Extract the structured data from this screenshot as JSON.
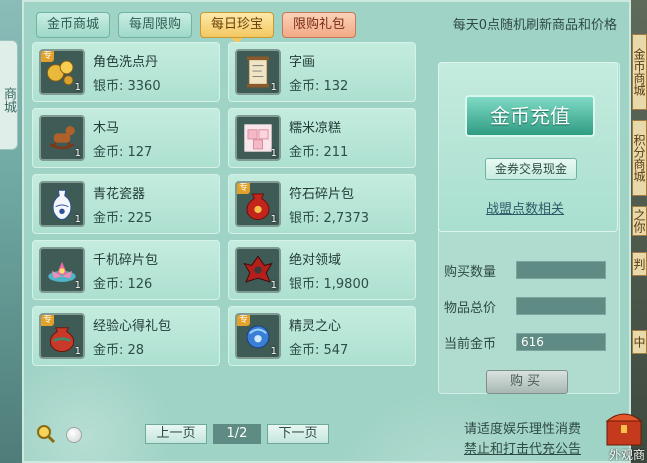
{
  "left_tag": "商城",
  "right_tabs": [
    "金币商城",
    "积分商城",
    "之你",
    "判",
    "中"
  ],
  "tabs": [
    {
      "label": "金币商城"
    },
    {
      "label": "每周限购"
    },
    {
      "label": "每日珍宝"
    },
    {
      "label": "限购礼包"
    }
  ],
  "notice": "每天0点随机刷新商品和价格",
  "items": [
    {
      "name": "角色洗点丹",
      "price": "银币: 3360",
      "qty": "1",
      "badge": "专",
      "icon": "gold-pill-icon"
    },
    {
      "name": "字画",
      "price": "金币: 132",
      "qty": "1",
      "badge": "",
      "icon": "scroll-icon"
    },
    {
      "name": "木马",
      "price": "金币: 127",
      "qty": "1",
      "badge": "",
      "icon": "wooden-horse-icon"
    },
    {
      "name": "糯米凉糕",
      "price": "金币: 211",
      "qty": "1",
      "badge": "",
      "icon": "rice-cake-icon"
    },
    {
      "name": "青花瓷器",
      "price": "金币: 225",
      "qty": "1",
      "badge": "",
      "icon": "porcelain-vase-icon"
    },
    {
      "name": "符石碎片包",
      "price": "银币: 2,7373",
      "qty": "1",
      "badge": "专",
      "icon": "red-pouch-icon"
    },
    {
      "name": "千机碎片包",
      "price": "金币: 126",
      "qty": "1",
      "badge": "",
      "icon": "lotus-gem-icon"
    },
    {
      "name": "绝对领域",
      "price": "银币: 1,9800",
      "qty": "1",
      "badge": "",
      "icon": "red-mech-icon"
    },
    {
      "name": "经验心得礼包",
      "price": "金币: 28",
      "qty": "1",
      "badge": "专",
      "icon": "gift-bag-icon"
    },
    {
      "name": "精灵之心",
      "price": "金币: 547",
      "qty": "1",
      "badge": "专",
      "icon": "blue-orb-icon"
    }
  ],
  "side": {
    "recharge": "金币充值",
    "exchange": "金券交易现金",
    "guild_link": "战盟点数相关",
    "buy_qty_label": "购买数量",
    "buy_qty_value": "",
    "total_label": "物品总价",
    "total_value": "",
    "current_gold_label": "当前金币",
    "current_gold_value": "616",
    "buy_button": "购买"
  },
  "pager": {
    "prev": "上一页",
    "page": "1/2",
    "next": "下一页"
  },
  "footer": {
    "line1": "请适度娱乐理性消费",
    "line2": "禁止和打击代充公告"
  },
  "chest_label": "外观商"
}
